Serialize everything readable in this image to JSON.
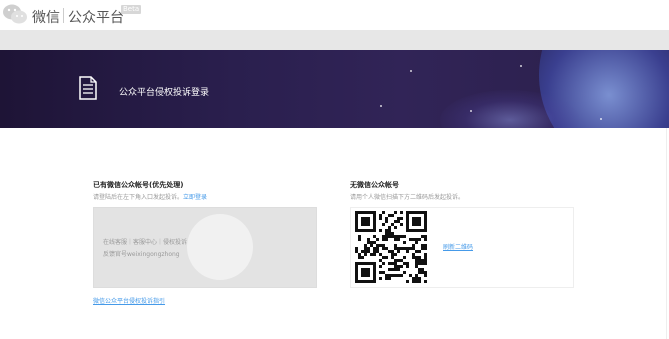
{
  "header": {
    "brand_name": "微信",
    "platform_name": "公众平台",
    "beta_badge": "Beta"
  },
  "banner": {
    "title": "公众平台侵权投诉登录"
  },
  "left_panel": {
    "title": "已有微信公众帐号(优先处理)",
    "subtitle_prefix": "请登陆后在左下角入口发起投诉。",
    "login_link": "立即登录",
    "info_line1": "在线客服｜客服中心｜侵权投诉",
    "info_line2": "反馈官号weixingongzhong",
    "guide_link": "微信公众平台侵权投诉指引"
  },
  "right_panel": {
    "title": "无微信公众帐号",
    "subtitle": "请用个人微信扫描下方二维码后发起投诉。",
    "refresh_label": "刷新二维码"
  },
  "colors": {
    "link": "#459ae9",
    "banner_dark": "#1e1436",
    "panel_grey": "#e3e3e3"
  }
}
